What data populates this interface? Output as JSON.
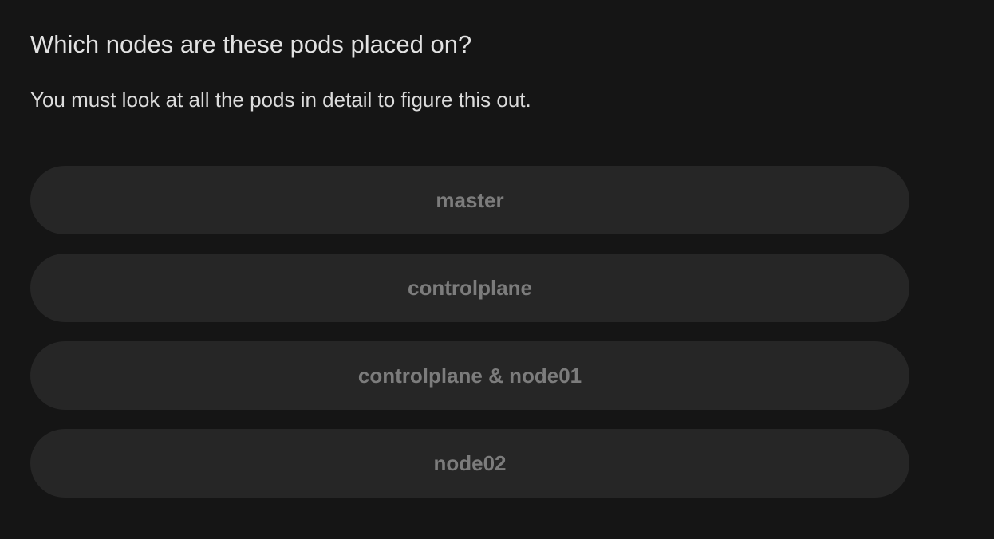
{
  "question": {
    "title": "Which nodes are these pods placed on?",
    "hint": "You must look at all the pods in detail to figure this out."
  },
  "options": [
    {
      "label": "master"
    },
    {
      "label": "controlplane"
    },
    {
      "label": "controlplane & node01"
    },
    {
      "label": "node02"
    }
  ],
  "colors": {
    "background": "#151515",
    "option_background": "#262626",
    "option_text": "#7c7c7c",
    "text": "#e2e2e2"
  }
}
